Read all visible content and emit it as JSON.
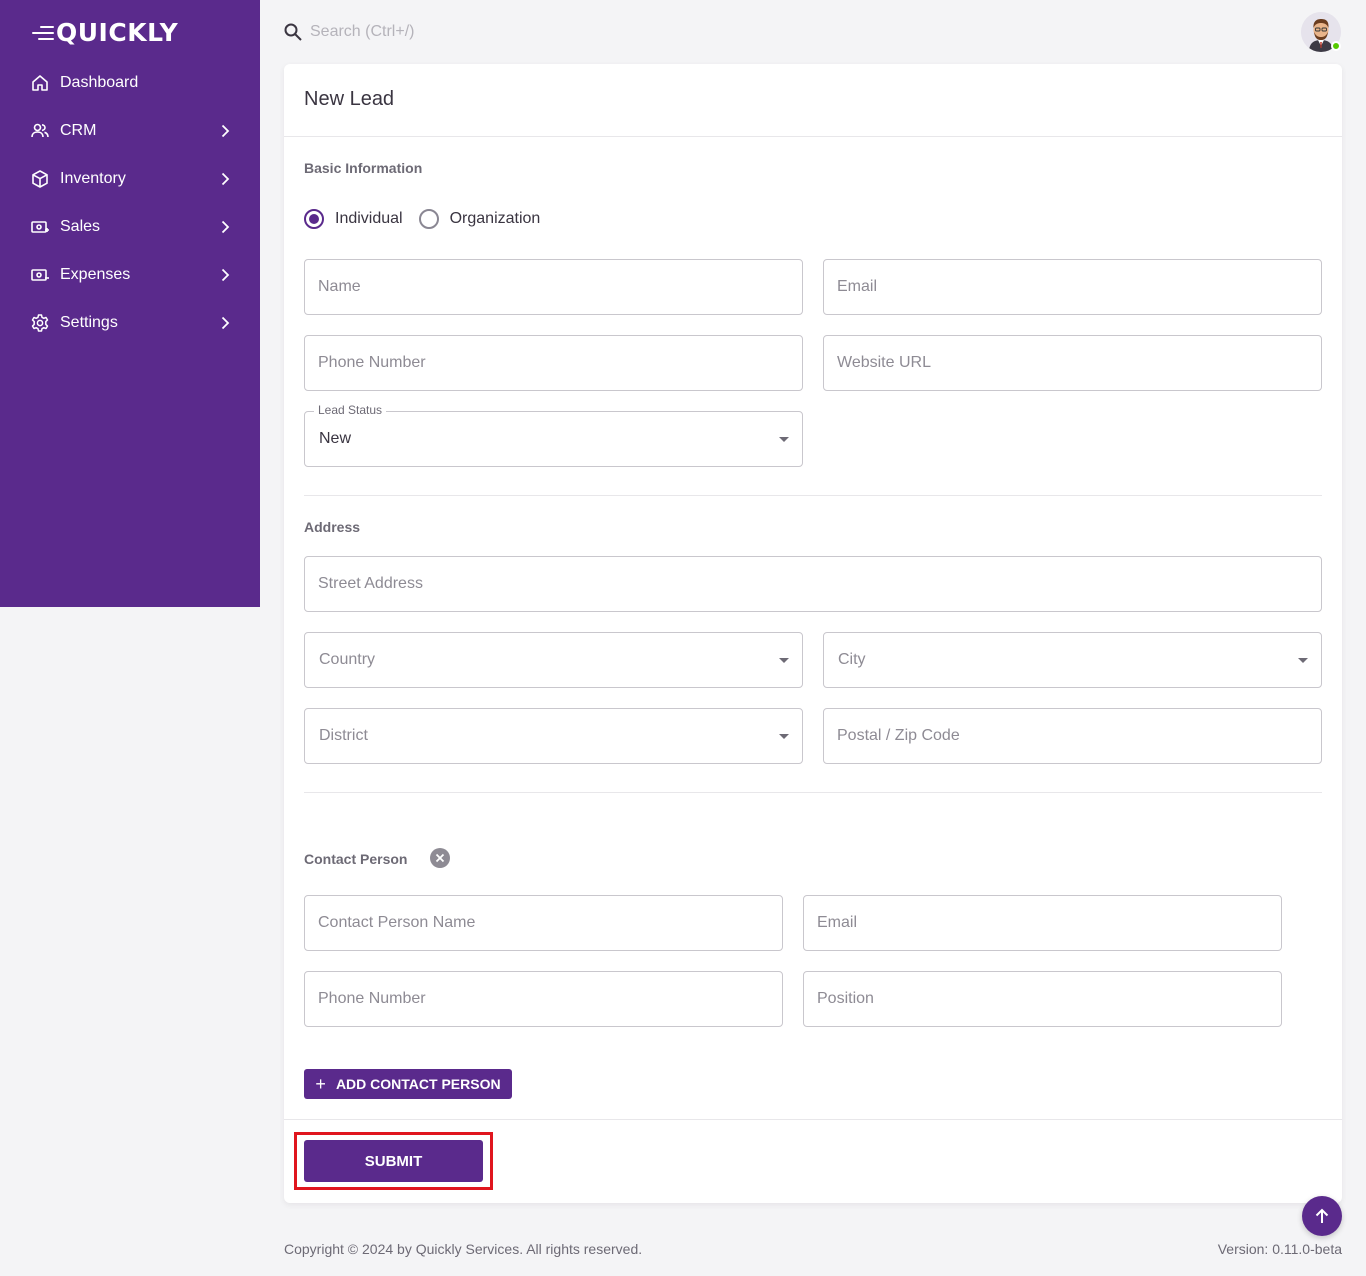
{
  "app": {
    "logo_text": "QUICKLY"
  },
  "sidebar": {
    "items": [
      {
        "label": "Dashboard",
        "icon": "home-icon",
        "has_children": false
      },
      {
        "label": "CRM",
        "icon": "users-icon",
        "has_children": true
      },
      {
        "label": "Inventory",
        "icon": "box-icon",
        "has_children": true
      },
      {
        "label": "Sales",
        "icon": "sales-icon",
        "has_children": true
      },
      {
        "label": "Expenses",
        "icon": "expenses-icon",
        "has_children": true
      },
      {
        "label": "Settings",
        "icon": "gear-icon",
        "has_children": true
      }
    ]
  },
  "topbar": {
    "search_placeholder": "Search (Ctrl+/)",
    "user_status": "online"
  },
  "form": {
    "title": "New Lead",
    "basic_section": "Basic Information",
    "lead_type": {
      "options": [
        "Individual",
        "Organization"
      ],
      "selected": "Individual"
    },
    "name_placeholder": "Name",
    "email_placeholder": "Email",
    "phone_placeholder": "Phone Number",
    "website_placeholder": "Website URL",
    "lead_status_label": "Lead Status",
    "lead_status_value": "New",
    "address_section": "Address",
    "street_placeholder": "Street Address",
    "country_placeholder": "Country",
    "city_placeholder": "City",
    "district_placeholder": "District",
    "postal_placeholder": "Postal / Zip Code",
    "contact_section": "Contact Person",
    "contact_name_placeholder": "Contact Person Name",
    "contact_email_placeholder": "Email",
    "contact_phone_placeholder": "Phone Number",
    "contact_position_placeholder": "Position",
    "add_contact_label": "ADD CONTACT PERSON",
    "submit_label": "SUBMIT"
  },
  "footer": {
    "copyright": "Copyright © 2024 by Quickly Services. All rights reserved.",
    "version": "Version: 0.11.0-beta"
  },
  "colors": {
    "primary": "#5a2a8c",
    "highlight_border": "#e0161e",
    "online": "#56ca00"
  }
}
